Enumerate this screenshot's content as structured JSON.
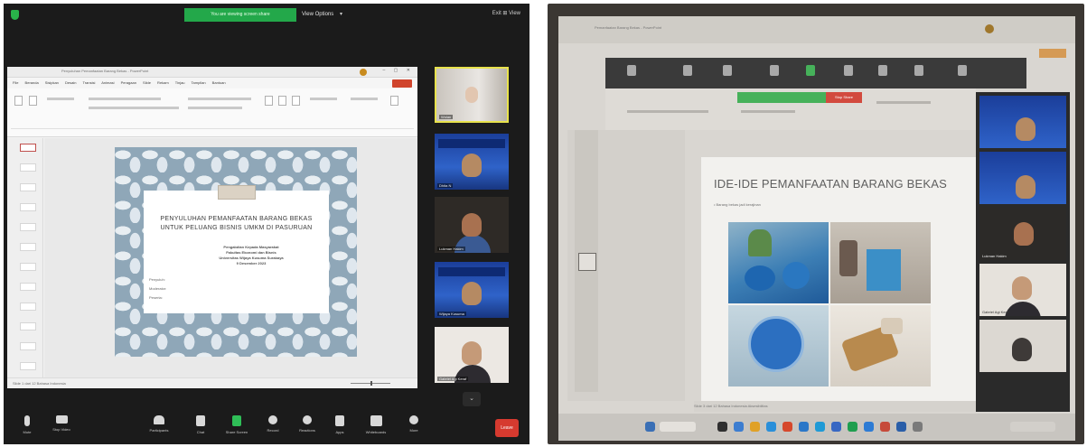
{
  "left_meeting": {
    "share_banner": "You are viewing screen share",
    "view_options": "View Options",
    "view_chevron": "▾",
    "top_right": "Exit  ⊞ View",
    "presentation": {
      "window_title": "Penyuluhan Pemanfaatan Barang Bekas - PowerPoint",
      "window_controls": "– ▢ ✕",
      "menu": "File Beranda Sisipkan Desain Transisi Animasi Peragaan Slide Rekam Tinjau Tampilan Bantuan",
      "status_left": "Slide 1 dari 12   Bahasa Indonesia",
      "slide": {
        "title_line1": "PENYULUHAN PEMANFAATAN BARANG BEKAS",
        "title_line2": "UNTUK PELUANG BISNIS UMKM DI PASURUAN",
        "org_lines": [
          "Pengabdian Kepada Masyarakat",
          "Fakultas Ekonomi dan Bisnis",
          "Universitas Wijaya Kusuma Surabaya",
          "9 Desember 2023"
        ],
        "meta_lines": [
          "Penyuluh:",
          "Moderator:",
          "Peserta:"
        ]
      }
    },
    "participants": [
      {
        "name": "Wulan"
      },
      {
        "name": "Dhita N"
      },
      {
        "name": "Lukman Hakim"
      },
      {
        "name": "Wijaya Kusuma"
      },
      {
        "name": "Gabriel Agi Keraf"
      }
    ],
    "toolbar": [
      {
        "label": "Mute"
      },
      {
        "label": "Stop Video"
      },
      {
        "label": "Participants"
      },
      {
        "label": "Chat"
      },
      {
        "label": "Share Screen"
      },
      {
        "label": "Record"
      },
      {
        "label": "Reactions"
      },
      {
        "label": "Apps"
      },
      {
        "label": "Whiteboards"
      },
      {
        "label": "More"
      }
    ],
    "leave_label": "Leave"
  },
  "right_photo": {
    "tab_text": "Pemanfaatan Barang Bekas - PowerPoint",
    "share_stop_label": "Stop Share",
    "slide": {
      "title": "IDE-IDE PEMANFAATAN BARANG BEKAS",
      "bullet": "• Barang bekas jadi kerajinan"
    },
    "status_text": "Slide 3 dari 12   Bahasa Indonesia   Aksesibilitas",
    "participants": [
      {
        "name": ""
      },
      {
        "name": ""
      },
      {
        "name": "Lukman Hakim"
      },
      {
        "name": "Gabriel Agi Keraf"
      },
      {
        "name": ""
      }
    ]
  },
  "colors": {
    "zoom_bg": "#1b1b1b",
    "share_green": "#23a84a",
    "leave_red": "#d63a2f",
    "active_speaker": "#e8e24c",
    "slide_pattern": "#8fa7b8"
  }
}
